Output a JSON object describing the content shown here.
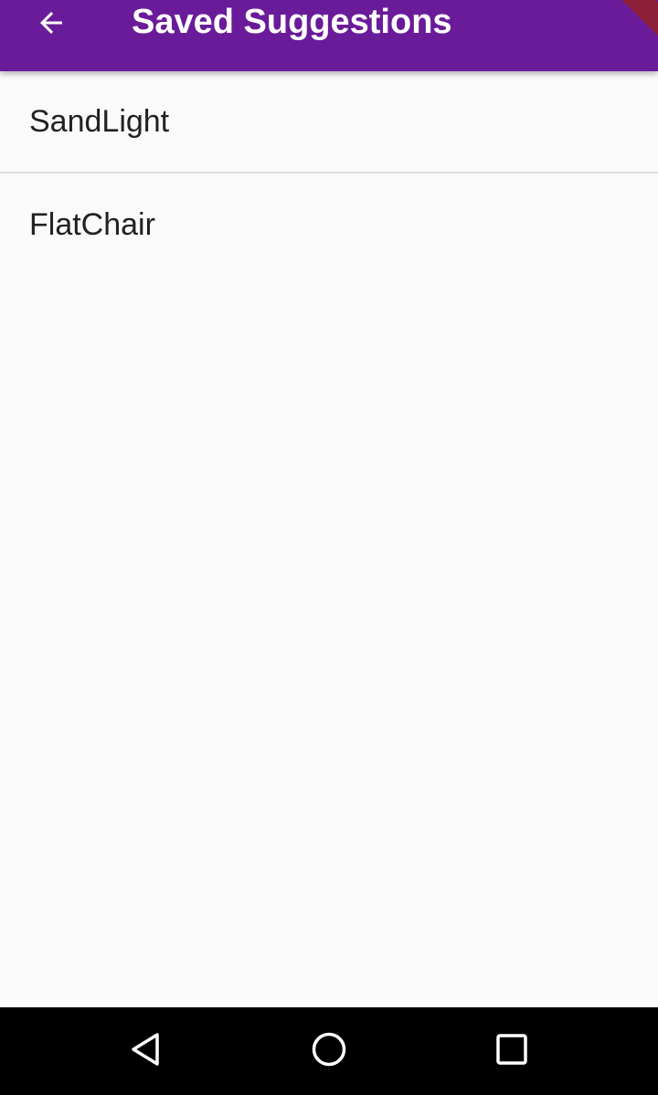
{
  "app_bar": {
    "title": "Saved Suggestions",
    "back_icon": "arrow-back-icon",
    "color": "#6a1b9a"
  },
  "saved_list": {
    "items": [
      {
        "label": "SandLight"
      },
      {
        "label": "FlatChair"
      }
    ]
  },
  "system_nav": {
    "back_icon": "triangle-back-icon",
    "home_icon": "circle-home-icon",
    "recents_icon": "square-recents-icon"
  }
}
